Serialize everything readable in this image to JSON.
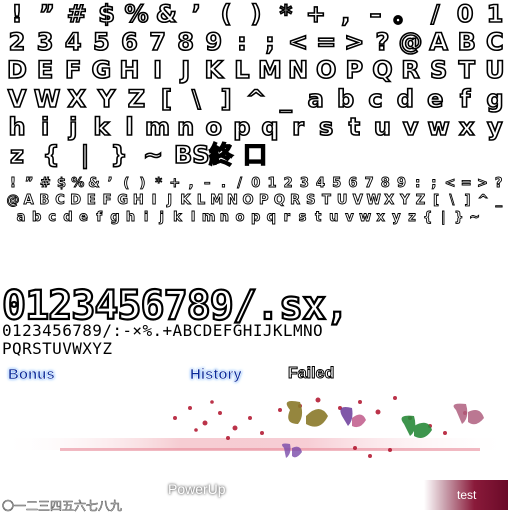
{
  "big_font_rows": [
    [
      "!",
      "”",
      "#",
      "$",
      "%",
      "&",
      "’",
      "(",
      ")",
      "*",
      "+",
      ",",
      "–",
      "。",
      "/",
      "0",
      "1"
    ],
    [
      "2",
      "3",
      "4",
      "5",
      "6",
      "7",
      "8",
      "9",
      ":",
      ";",
      "<",
      "=",
      ">",
      "?",
      "@",
      "A",
      "B",
      "C"
    ],
    [
      "D",
      "E",
      "F",
      "G",
      "H",
      "I",
      "J",
      "K",
      "L",
      "M",
      "N",
      "O",
      "P",
      "Q",
      "R",
      "S",
      "T",
      "U"
    ],
    [
      "V",
      "W",
      "X",
      "Y",
      "Z",
      "[",
      "\\",
      "]",
      "^",
      "_",
      "a",
      "b",
      "c",
      "d",
      "e",
      "f",
      "g"
    ],
    [
      "h",
      "i",
      "j",
      "k",
      "l",
      "m",
      "n",
      "o",
      "p",
      "q",
      "r",
      "s",
      "t",
      "u",
      "v",
      "w",
      "x",
      "y"
    ],
    [
      "z",
      "{",
      "|",
      "}",
      "~",
      "BS",
      "終",
      "口"
    ]
  ],
  "small_font_rows": [
    "! ” # $ % & ’ ( ) * + , – . / 0 1 2 3 4 5 6 7 8 9 : ; < = > ?",
    "@ A B C D E F G H I J K L M N O P Q R S T U V W X Y Z [ \\ ] ^ _",
    "a b c d e f g h i j k l m n o p q r s t u v w x y z { | } ~"
  ],
  "digits_big": "0123456789/.sx,",
  "digits_mid_line1": "0123456789/:-×%.+ABCDEFGHIJKLMNO",
  "digits_mid_line2": "PQRSTUVWXYZ",
  "labels": {
    "bonus": "Bonus",
    "history": "History",
    "failed": "Failed",
    "powerup": "PowerUp",
    "kanji": "〇一二三四五六七八九",
    "test": "test"
  },
  "colors": {
    "blue_label": "#0a2a9a",
    "streak_red": "#c0102a",
    "butterfly_olive": "#8a7a2a",
    "butterfly_green": "#2a8a3a",
    "butterfly_purple": "#6a3a9a",
    "butterfly_pink": "#c05a8a",
    "test_button": "#7a1030"
  }
}
